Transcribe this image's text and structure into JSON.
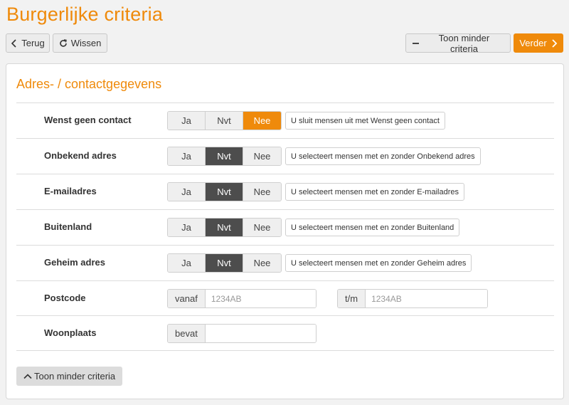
{
  "page": {
    "title": "Burgerlijke criteria"
  },
  "toolbar": {
    "back_label": "Terug",
    "back_icon": "chevron-left-icon",
    "clear_label": "Wissen",
    "clear_icon": "refresh-icon",
    "less_criteria_label": "Toon minder criteria",
    "less_criteria_icon": "minus-icon",
    "next_label": "Verder",
    "next_icon": "chevron-right-icon"
  },
  "colors": {
    "accent": "#ef8a0b",
    "selected_dark": "#4d4d4d"
  },
  "panel": {
    "title": "Adres- / contactgegevens",
    "toggle_rows": [
      {
        "label": "Wenst geen contact",
        "options": [
          "Ja",
          "Nvt",
          "Nee"
        ],
        "selected": "Nee",
        "hint": "U sluit mensen uit met Wenst geen contact"
      },
      {
        "label": "Onbekend adres",
        "options": [
          "Ja",
          "Nvt",
          "Nee"
        ],
        "selected": "Nvt",
        "hint": "U selecteert mensen met en zonder Onbekend adres"
      },
      {
        "label": "E-mailadres",
        "options": [
          "Ja",
          "Nvt",
          "Nee"
        ],
        "selected": "Nvt",
        "hint": "U selecteert mensen met en zonder E-mailadres"
      },
      {
        "label": "Buitenland",
        "options": [
          "Ja",
          "Nvt",
          "Nee"
        ],
        "selected": "Nvt",
        "hint": "U selecteert mensen met en zonder Buitenland"
      },
      {
        "label": "Geheim adres",
        "options": [
          "Ja",
          "Nvt",
          "Nee"
        ],
        "selected": "Nvt",
        "hint": "U selecteert mensen met en zonder Geheim adres"
      }
    ],
    "postcode": {
      "label": "Postcode",
      "from_addon": "vanaf",
      "from_value": "",
      "from_placeholder": "1234AB",
      "to_addon": "t/m",
      "to_value": "",
      "to_placeholder": "1234AB"
    },
    "woonplaats": {
      "label": "Woonplaats",
      "addon": "bevat",
      "value": "",
      "placeholder": ""
    },
    "footer_button_label": "Toon minder criteria",
    "footer_button_icon": "chevron-up-icon"
  }
}
